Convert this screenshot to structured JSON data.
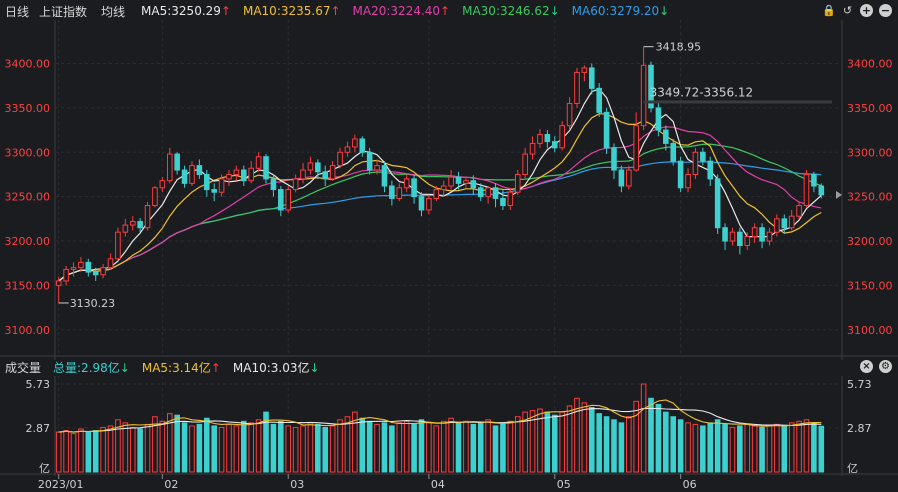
{
  "header": {
    "period": "日线",
    "index_name": "上证指数",
    "indicator": "均线",
    "ma": [
      {
        "label": "MA5:3250.29",
        "arrow": "↑",
        "color": "#e8e8e8",
        "arrow_color": "#ff3b3b"
      },
      {
        "label": "MA10:3235.67",
        "arrow": "↑",
        "color": "#f0c030",
        "arrow_color": "#ff3b3b"
      },
      {
        "label": "MA20:3224.40",
        "arrow": "↑",
        "color": "#e040a8",
        "arrow_color": "#ff3b3b"
      },
      {
        "label": "MA30:3246.62",
        "arrow": "↓",
        "color": "#3cc860",
        "arrow_color": "#2fd08a"
      },
      {
        "label": "MA60:3279.20",
        "arrow": "↓",
        "color": "#2f9ee8",
        "arrow_color": "#2fd08a"
      }
    ],
    "tools": [
      "lock-icon",
      "undo-icon",
      "zoom-in-icon",
      "zoom-out-icon"
    ]
  },
  "volume_header": {
    "title": "成交量",
    "total": {
      "label": "总量:2.98亿",
      "arrow": "↓",
      "color": "#3ecfcf",
      "arrow_color": "#2fd08a"
    },
    "ma5": {
      "label": "MA5:3.14亿",
      "arrow": "↑",
      "color": "#f0c030",
      "arrow_color": "#ff3b3b"
    },
    "ma10": {
      "label": "MA10:3.03亿",
      "arrow": "↓",
      "color": "#e8e8e8",
      "arrow_color": "#2fd08a"
    },
    "tools": [
      "close-icon",
      "settings-icon"
    ]
  },
  "chart_data": {
    "type": "candlestick",
    "price_axis": {
      "ylim": [
        3075,
        3440
      ],
      "ticks": [
        "3400.00",
        "3350.00",
        "3300.00",
        "3250.00",
        "3200.00",
        "3150.00",
        "3100.00"
      ]
    },
    "volume_axis": {
      "ylim": [
        0,
        5.73
      ],
      "ticks": [
        "5.73",
        "2.87",
        "亿"
      ]
    },
    "x_ticks": [
      {
        "label": "2023/01",
        "index": 0
      },
      {
        "label": "02",
        "index": 14
      },
      {
        "label": "03",
        "index": 31
      },
      {
        "label": "04",
        "index": 50
      },
      {
        "label": "05",
        "index": 67
      },
      {
        "label": "06",
        "index": 84
      }
    ],
    "annotations": {
      "high": "3418.95",
      "low": "3130.23",
      "range": "3349.72-3356.12"
    },
    "colors": {
      "up": "#ff3b3b",
      "down": "#3ecfcf",
      "ma5": "#e8e8e8",
      "ma10": "#f0c030",
      "ma20": "#e040a8",
      "ma30": "#3cc860",
      "ma60": "#2f9ee8"
    },
    "candles": [
      [
        3150,
        3155,
        3130,
        3160
      ],
      [
        3155,
        3168,
        3150,
        3172
      ],
      [
        3168,
        3170,
        3160,
        3176
      ],
      [
        3170,
        3176,
        3165,
        3182
      ],
      [
        3176,
        3165,
        3160,
        3180
      ],
      [
        3165,
        3162,
        3155,
        3170
      ],
      [
        3162,
        3170,
        3158,
        3174
      ],
      [
        3170,
        3180,
        3168,
        3186
      ],
      [
        3180,
        3210,
        3178,
        3215
      ],
      [
        3210,
        3218,
        3205,
        3225
      ],
      [
        3218,
        3222,
        3212,
        3228
      ],
      [
        3222,
        3215,
        3210,
        3226
      ],
      [
        3215,
        3240,
        3212,
        3244
      ],
      [
        3240,
        3260,
        3238,
        3262
      ],
      [
        3260,
        3268,
        3255,
        3272
      ],
      [
        3268,
        3298,
        3265,
        3305
      ],
      [
        3298,
        3280,
        3275,
        3300
      ],
      [
        3280,
        3265,
        3260,
        3285
      ],
      [
        3265,
        3285,
        3262,
        3290
      ],
      [
        3285,
        3275,
        3270,
        3292
      ],
      [
        3275,
        3258,
        3250,
        3280
      ],
      [
        3258,
        3255,
        3245,
        3265
      ],
      [
        3255,
        3270,
        3250,
        3275
      ],
      [
        3270,
        3275,
        3262,
        3280
      ],
      [
        3275,
        3280,
        3268,
        3285
      ],
      [
        3280,
        3268,
        3262,
        3285
      ],
      [
        3268,
        3282,
        3265,
        3290
      ],
      [
        3282,
        3295,
        3278,
        3300
      ],
      [
        3295,
        3270,
        3265,
        3298
      ],
      [
        3270,
        3258,
        3250,
        3275
      ],
      [
        3258,
        3235,
        3228,
        3262
      ],
      [
        3235,
        3258,
        3232,
        3262
      ],
      [
        3258,
        3270,
        3255,
        3275
      ],
      [
        3270,
        3280,
        3265,
        3288
      ],
      [
        3280,
        3288,
        3275,
        3295
      ],
      [
        3288,
        3278,
        3270,
        3292
      ],
      [
        3278,
        3270,
        3262,
        3285
      ],
      [
        3270,
        3285,
        3268,
        3290
      ],
      [
        3285,
        3300,
        3282,
        3305
      ],
      [
        3300,
        3306,
        3295,
        3312
      ],
      [
        3306,
        3315,
        3300,
        3320
      ],
      [
        3315,
        3300,
        3295,
        3318
      ],
      [
        3300,
        3280,
        3275,
        3305
      ],
      [
        3280,
        3285,
        3275,
        3292
      ],
      [
        3285,
        3262,
        3255,
        3290
      ],
      [
        3262,
        3248,
        3240,
        3268
      ],
      [
        3248,
        3260,
        3245,
        3265
      ],
      [
        3260,
        3270,
        3255,
        3275
      ],
      [
        3270,
        3250,
        3242,
        3275
      ],
      [
        3250,
        3235,
        3228,
        3255
      ],
      [
        3235,
        3248,
        3230,
        3252
      ],
      [
        3248,
        3258,
        3245,
        3262
      ],
      [
        3258,
        3262,
        3250,
        3268
      ],
      [
        3262,
        3272,
        3258,
        3280
      ],
      [
        3272,
        3265,
        3258,
        3278
      ],
      [
        3265,
        3268,
        3260,
        3272
      ],
      [
        3268,
        3260,
        3252,
        3274
      ],
      [
        3260,
        3250,
        3245,
        3265
      ],
      [
        3250,
        3260,
        3242,
        3262
      ],
      [
        3260,
        3248,
        3238,
        3265
      ],
      [
        3248,
        3240,
        3235,
        3258
      ],
      [
        3240,
        3255,
        3235,
        3260
      ],
      [
        3255,
        3275,
        3252,
        3280
      ],
      [
        3275,
        3298,
        3270,
        3305
      ],
      [
        3298,
        3310,
        3292,
        3318
      ],
      [
        3310,
        3320,
        3305,
        3326
      ],
      [
        3320,
        3312,
        3305,
        3325
      ],
      [
        3312,
        3305,
        3300,
        3318
      ],
      [
        3305,
        3330,
        3302,
        3335
      ],
      [
        3330,
        3355,
        3325,
        3362
      ],
      [
        3355,
        3390,
        3350,
        3395
      ],
      [
        3390,
        3395,
        3380,
        3398
      ],
      [
        3395,
        3372,
        3365,
        3400
      ],
      [
        3372,
        3345,
        3340,
        3378
      ],
      [
        3345,
        3305,
        3298,
        3350
      ],
      [
        3305,
        3280,
        3270,
        3310
      ],
      [
        3280,
        3262,
        3255,
        3285
      ],
      [
        3262,
        3280,
        3258,
        3285
      ],
      [
        3280,
        3330,
        3278,
        3345
      ],
      [
        3330,
        3398,
        3325,
        3418.95
      ],
      [
        3398,
        3350,
        3345,
        3402
      ],
      [
        3350,
        3325,
        3318,
        3356
      ],
      [
        3325,
        3310,
        3302,
        3330
      ],
      [
        3310,
        3290,
        3285,
        3315
      ],
      [
        3290,
        3260,
        3255,
        3295
      ],
      [
        3260,
        3275,
        3255,
        3282
      ],
      [
        3275,
        3300,
        3270,
        3305
      ],
      [
        3300,
        3290,
        3285,
        3305
      ],
      [
        3290,
        3270,
        3262,
        3295
      ],
      [
        3270,
        3215,
        3208,
        3275
      ],
      [
        3215,
        3200,
        3190,
        3220
      ],
      [
        3200,
        3210,
        3195,
        3215
      ],
      [
        3210,
        3195,
        3185,
        3215
      ],
      [
        3195,
        3205,
        3190,
        3210
      ],
      [
        3205,
        3215,
        3198,
        3220
      ],
      [
        3215,
        3200,
        3192,
        3220
      ],
      [
        3200,
        3210,
        3195,
        3215
      ],
      [
        3210,
        3225,
        3205,
        3230
      ],
      [
        3225,
        3215,
        3208,
        3230
      ],
      [
        3215,
        3228,
        3212,
        3235
      ],
      [
        3228,
        3240,
        3225,
        3245
      ],
      [
        3240,
        3275,
        3238,
        3280
      ],
      [
        3275,
        3262,
        3255,
        3278
      ],
      [
        3262,
        3252,
        3248,
        3265
      ]
    ],
    "volumes": [
      2.6,
      2.7,
      2.5,
      2.8,
      2.6,
      2.7,
      2.9,
      3.0,
      3.4,
      3.2,
      2.9,
      2.8,
      3.1,
      3.6,
      3.3,
      3.8,
      3.7,
      3.2,
      3.0,
      3.1,
      3.5,
      3.0,
      2.9,
      3.1,
      3.0,
      3.3,
      3.2,
      3.4,
      3.9,
      3.1,
      3.3,
      3.0,
      2.9,
      3.0,
      3.2,
      3.1,
      2.9,
      3.0,
      3.4,
      3.6,
      3.9,
      3.5,
      3.3,
      3.1,
      3.2,
      3.0,
      3.2,
      3.3,
      3.1,
      3.4,
      3.2,
      3.0,
      3.3,
      3.5,
      3.2,
      3.3,
      3.1,
      3.2,
      3.4,
      3.0,
      3.1,
      3.3,
      3.6,
      3.9,
      4.0,
      4.1,
      3.9,
      3.7,
      3.9,
      4.3,
      4.8,
      4.5,
      4.2,
      3.8,
      3.6,
      3.4,
      3.2,
      3.6,
      4.6,
      5.73,
      4.8,
      4.4,
      3.9,
      3.6,
      3.4,
      3.2,
      3.1,
      3.0,
      3.2,
      3.4,
      3.1,
      2.9,
      3.0,
      3.1,
      3.0,
      2.9,
      3.0,
      3.1,
      3.0,
      3.2,
      3.3,
      3.4,
      3.2,
      2.98
    ]
  }
}
